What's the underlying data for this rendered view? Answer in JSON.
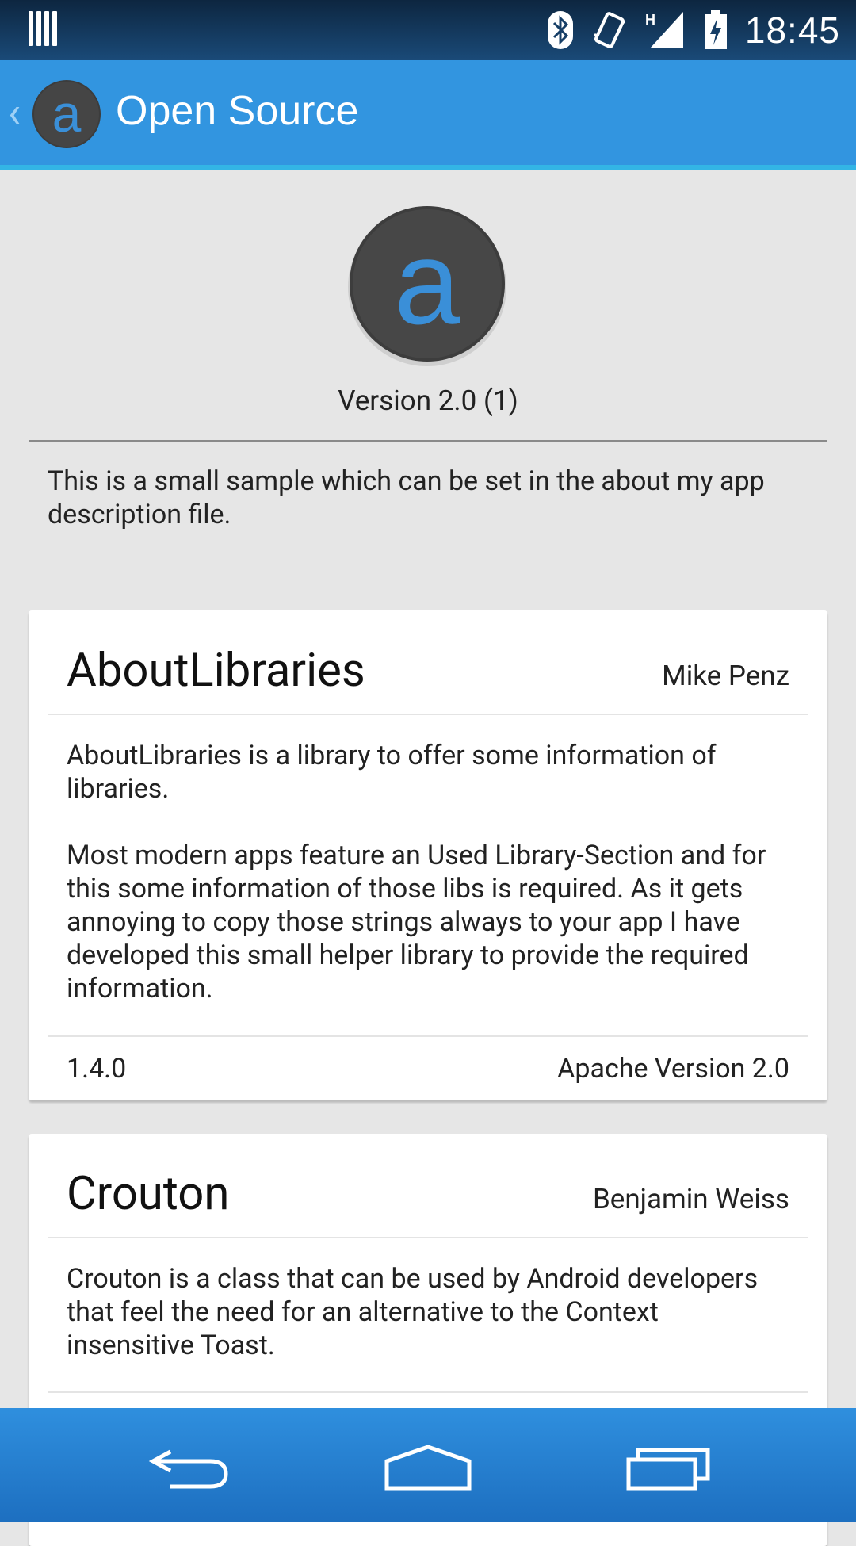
{
  "status_bar": {
    "time": "18:45",
    "network_type": "H",
    "icons": [
      "notification-icon",
      "bluetooth-icon",
      "vibrate-icon",
      "signal-icon",
      "battery-charging-icon"
    ]
  },
  "action_bar": {
    "title": "Open Source",
    "app_icon_letter": "a"
  },
  "header": {
    "logo_letter": "a",
    "version": "Version 2.0 (1)",
    "description": "This is a small sample which can be set in the about my app description file."
  },
  "libraries": [
    {
      "name": "AboutLibraries",
      "author": "Mike Penz",
      "description": "AboutLibraries is a library to offer some information of libraries.\n\n Most modern apps feature an Used Library-Section and for this some information of those libs is required. As it gets annoying to copy those strings always to your app I have developed this small helper library to provide the required information.",
      "version": "1.4.0",
      "license": "Apache Version 2.0"
    },
    {
      "name": "Crouton",
      "author": "Benjamin Weiss",
      "description": "Crouton is a class that can be used by Android developers that feel the need for an alternative to the Context insensitive Toast."
    }
  ],
  "colors": {
    "action_bar": "#3295e0",
    "accent": "#33b5e5",
    "logo_letter": "#3a8fd8",
    "logo_circle": "#444444",
    "background": "#e6e6e6"
  }
}
